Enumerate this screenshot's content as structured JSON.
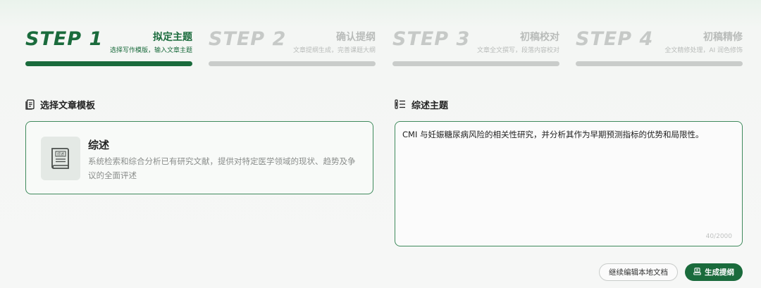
{
  "steps": [
    {
      "num": "STEP 1",
      "title": "拟定主题",
      "sub": "选择写作模版，输入文章主题",
      "active": true
    },
    {
      "num": "STEP 2",
      "title": "确认提纲",
      "sub": "文章提纲生成，完善课题大纲",
      "active": false
    },
    {
      "num": "STEP 3",
      "title": "初稿校对",
      "sub": "文章全文撰写，段落内容校对",
      "active": false
    },
    {
      "num": "STEP 4",
      "title": "初稿精修",
      "sub": "全文精修处理，AI 润色修饰",
      "active": false
    }
  ],
  "template_section": {
    "heading": "选择文章模板",
    "icon": "document-list-icon",
    "card": {
      "icon": "review-book-icon",
      "icon_text": "综述",
      "name": "综述",
      "description": "系统检索和综合分析已有研究文献，提供对特定医学领域的现状、趋势及争议的全面评述"
    }
  },
  "topic_section": {
    "heading": "综述主题",
    "icon": "text-list-icon",
    "value": "CMI 与妊娠糖尿病风险的相关性研究，并分析其作为早期预测指标的优势和局限性。",
    "counter": "40/2000"
  },
  "actions": {
    "continue_label": "继续编辑本地文档",
    "generate_label": "生成提纲",
    "generate_icon": "outline-generate-icon"
  },
  "colors": {
    "accent": "#1a6b3c",
    "inactive": "#c9ccca"
  }
}
